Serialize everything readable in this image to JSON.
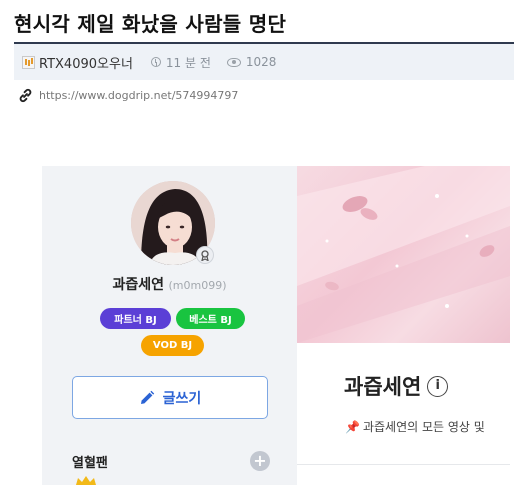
{
  "post": {
    "title": "현시각 제일 화났을 사람들 명단",
    "author": "RTX4090오우너",
    "time": "11 분 전",
    "views": "1028",
    "url": "https://www.dogdrip.net/574994797"
  },
  "profile": {
    "nickname": "과즙세연",
    "user_id": "(m0m099)",
    "badges": [
      "파트너 BJ",
      "베스트 BJ",
      "VOD BJ"
    ],
    "write_label": "글쓰기",
    "fan_section": "열혈팬"
  },
  "station": {
    "name": "과즙세연",
    "info_glyph": "i",
    "description": "과즙세연의 모든 영상 및"
  },
  "colors": {
    "partner_badge": "#5b3fd6",
    "best_badge": "#19c440",
    "vod_badge": "#f6a300",
    "write_button": "#2b63d4"
  },
  "icons": [
    "author-level-icon",
    "clock-icon",
    "eye-icon",
    "link-icon",
    "pencil-icon",
    "plus-icon",
    "pin-icon",
    "info-icon",
    "crown-icon"
  ]
}
